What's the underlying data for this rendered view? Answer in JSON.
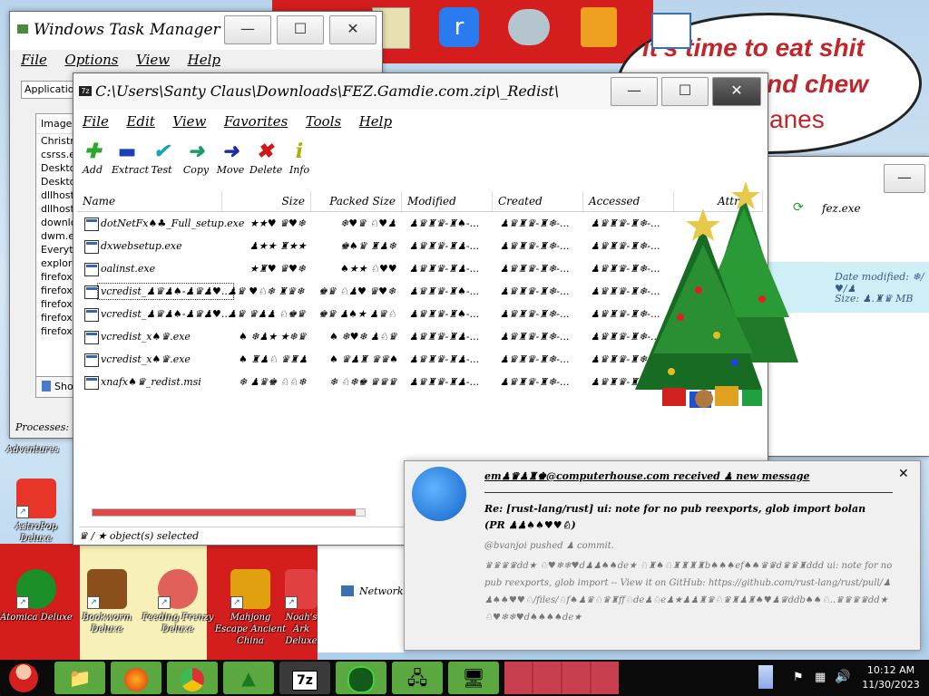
{
  "desktop": {
    "speech_text": "it's time to eat shit and chew ... anes",
    "speech_line1": "it's time to eat shit",
    "speech_line2": "nd chew",
    "speech_line3": "anes",
    "icons": [
      {
        "label": "Adventures"
      },
      {
        "label": "AstroPop Deluxe"
      },
      {
        "label": "Atomica Deluxe"
      },
      {
        "label": "Bookworm Deluxe"
      },
      {
        "label": "Feeding Frenzy Deluxe"
      },
      {
        "label": "Mahjong Escape Ancient China"
      },
      {
        "label": "Noah's Ark Deluxe"
      }
    ]
  },
  "task_manager": {
    "title": "Windows Task Manager",
    "menu": [
      "File",
      "Options",
      "View",
      "Help"
    ],
    "tab": "Application",
    "column": "Image",
    "processes": [
      "Christm",
      "csrss.e",
      "Deskto",
      "Deskto",
      "dllhost.",
      "dllhost.",
      "downlo",
      "dwm.ex",
      "Everyth",
      "explore",
      "firefox",
      "firefox",
      "firefox",
      "firefox",
      "firefox"
    ],
    "show_button": "Sho",
    "status": "Processes: ♣"
  },
  "sevenzip": {
    "title": "C:\\Users\\Santy Claus\\Downloads\\FEZ.Gamdie.com.zip\\_Redist\\",
    "menu": [
      "File",
      "Edit",
      "View",
      "Favorites",
      "Tools",
      "Help"
    ],
    "toolbar": [
      {
        "label": "Add",
        "icon": "plus-icon",
        "glyph": "✚",
        "color": "#2aa82a"
      },
      {
        "label": "Extract",
        "icon": "minus-icon",
        "glyph": "▬",
        "color": "#1c3fb8"
      },
      {
        "label": "Test",
        "icon": "check-icon",
        "glyph": "✔",
        "color": "#1ba3b8"
      },
      {
        "label": "Copy",
        "icon": "copy-arrow-icon",
        "glyph": "➜",
        "color": "#1b9a6a"
      },
      {
        "label": "Move",
        "icon": "move-arrow-icon",
        "glyph": "➜",
        "color": "#1c2fa8"
      },
      {
        "label": "Delete",
        "icon": "delete-x-icon",
        "glyph": "✖",
        "color": "#d01818"
      },
      {
        "label": "Info",
        "icon": "info-icon",
        "glyph": "i",
        "color": "#b8a800"
      }
    ],
    "columns": [
      "Name",
      "Size",
      "Packed Size",
      "Modified",
      "Created",
      "Accessed",
      "Attr"
    ],
    "files": [
      {
        "name": "dotNetFx♠♣_Full_setup.exe",
        "size": "★★♥ ♛♥❄",
        "packed": "❄♥♛ ♘♥♟",
        "modified": "♟♛♜♛-♜♠-...",
        "created": "♟♛♜♛-♜❄-...",
        "accessed": "♟♛♜♛-♜❄-..."
      },
      {
        "name": "dxwebsetup.exe",
        "size": "♟★★ ♜★★",
        "packed": "♚♠♛ ♜♟❄",
        "modified": "♟♛♜♛-♜♟-...",
        "created": "♟♛♜♛-♜❄-...",
        "accessed": "♟♛♜♛-♜❄-..."
      },
      {
        "name": "oalinst.exe",
        "size": "★♜♥ ♛♥❄",
        "packed": "♠★★ ♘♥♥",
        "modified": "♟♛♜♛-♜♟-...",
        "created": "♟♛♜♛-♜❄-...",
        "accessed": "♟♛♜♛-♜❄-..."
      },
      {
        "name": "vcredist_♟♛♟♠-♟♛♟♥...",
        "size": "♟♛ ♥♘❄ ♜♛❄",
        "packed": "♚♛ ♘♟♥ ♛♥❄",
        "modified": "♟♛♜♛-♜♠-...",
        "created": "♟♛♜♛-♜❄-...",
        "accessed": "♟♛♜♛-♜❄-..."
      },
      {
        "name": "vcredist_♟♛♟♠-♟♛♟♥...",
        "size": "♟♛ ♛♟♟ ♘♚♛",
        "packed": "♚♛ ♟♠★ ♟♛♘",
        "modified": "♟♛♜♛-♜♠-...",
        "created": "♟♛♜♛-♜❄-...",
        "accessed": "♟♛♜♛-♜❄-..."
      },
      {
        "name": "vcredist_x♠♛.exe",
        "size": "♠ ❄♟★ ★❄♛",
        "packed": "♠ ❄♥❄ ♟♘♛",
        "modified": "♟♛♜♛-♜♟-...",
        "created": "♟♛♜♛-♜❄-...",
        "accessed": "♟♛♜♛-♜❄-..."
      },
      {
        "name": "vcredist_x♠♛.exe",
        "size": "♠ ♜♟♘ ♛♜♟",
        "packed": "♠ ♛♟♜ ♛♛♠",
        "modified": "♟♛♜♛-♜♟-...",
        "created": "♟♛♜♛-♜❄-...",
        "accessed": "♟♛♜♛-♜❄-..."
      },
      {
        "name": "xnafx♠♛_redist.msi",
        "size": "❄ ♟♛♚ ♘♘❄",
        "packed": "❄ ♘❄♚ ♛♛♛",
        "modified": "♟♛♜♛-♜♟-...",
        "created": "♟♛♜♛-♜❄-...",
        "accessed": "♟♛♜♛-♜❄-..."
      }
    ],
    "status": "♛ / ★ object(s) selected"
  },
  "explorer": {
    "search_text": "fez.exe",
    "date_label": "Date modified: ❄/♥/♟",
    "size_label": "Size: ♟.♜♛ MB",
    "network": "Network"
  },
  "notification": {
    "sender": "em♟♛♟♜♚@computerhouse.com received ♟ new message",
    "subject": "Re: [rust-lang/rust] ui: note for no pub reexports, glob import   bolan",
    "pr": "(PR ♟♟♠♠♥♥♘)",
    "body_line1": "@bvanjoi pushed ♟ commit.",
    "body_rest": "♛♛♛♛dd★ ♘♥❄❄♥d♟♟♠♠de★ ♘♜♠♘♜♜♜♜b♠♠♠ef♠♠♛♛d♛♛♜ddd ui: note for no pub reexports, glob import -- View it on GitHub: https://github.com/rust-lang/rust/pull/♟♟♠♠♥♥♘/files/♘f♠♟♛♘♛♜ff♘de♟♘e♟★♟♟♜♛♘♛♜♟♜♠♥♟♛ddb♠♠♘..♛♛♛♛dd★♘♥❄❄♥d♠♠♠♠de★",
    "close_glyph": "✕"
  },
  "taskbar": {
    "apps": [
      "File Explorer",
      "Firefox",
      "Chrome",
      "Christmas",
      "7z",
      "Atomica",
      "Network",
      "Computer"
    ],
    "sevenz_label": "7z",
    "time": "10:12 AM",
    "date": "11/30/2023"
  }
}
